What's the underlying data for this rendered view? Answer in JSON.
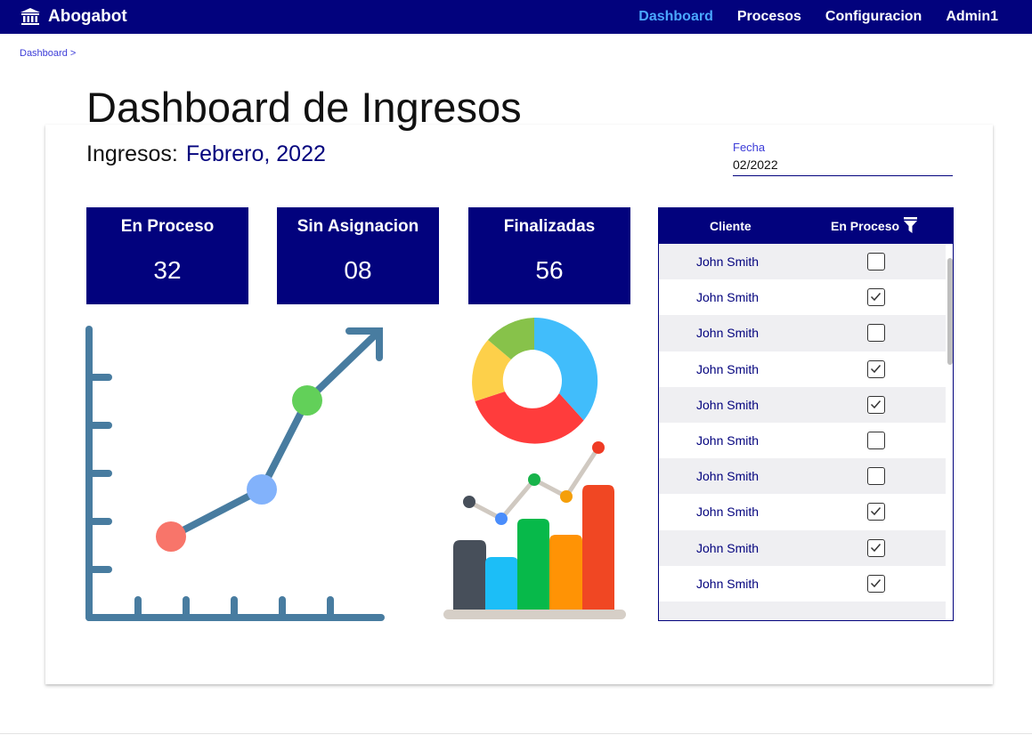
{
  "brand": {
    "name": "Abogabot",
    "icon": "courthouse-icon"
  },
  "nav": {
    "items": [
      {
        "label": "Dashboard",
        "active": true
      },
      {
        "label": "Procesos",
        "active": false
      },
      {
        "label": "Configuracion",
        "active": false
      },
      {
        "label": "Admin1",
        "active": false
      }
    ]
  },
  "breadcrumb": {
    "text": "Dashboard >"
  },
  "page": {
    "title": "Dashboard de Ingresos"
  },
  "ingresos": {
    "label": "Ingresos:",
    "month": "Febrero, 2022"
  },
  "fecha": {
    "label": "Fecha",
    "value": "02/2022"
  },
  "stats": [
    {
      "label": "En Proceso",
      "value": "32"
    },
    {
      "label": "Sin Asignacion",
      "value": "08"
    },
    {
      "label": "Finalizadas",
      "value": "56"
    }
  ],
  "clients": {
    "headers": {
      "cliente": "Cliente",
      "proceso": "En Proceso"
    },
    "filter_icon": "filter-icon",
    "rows": [
      {
        "name": "John Smith",
        "checked": false
      },
      {
        "name": "John Smith",
        "checked": true
      },
      {
        "name": "John Smith",
        "checked": false
      },
      {
        "name": "John Smith",
        "checked": true
      },
      {
        "name": "John Smith",
        "checked": true
      },
      {
        "name": "John Smith",
        "checked": false
      },
      {
        "name": "John Smith",
        "checked": false
      },
      {
        "name": "John Smith",
        "checked": true
      },
      {
        "name": "John Smith",
        "checked": true
      },
      {
        "name": "John Smith",
        "checked": true
      }
    ]
  },
  "colors": {
    "primary": "#02027d",
    "nav_active": "#4aa7ff",
    "row_shade": "#efeff2"
  }
}
